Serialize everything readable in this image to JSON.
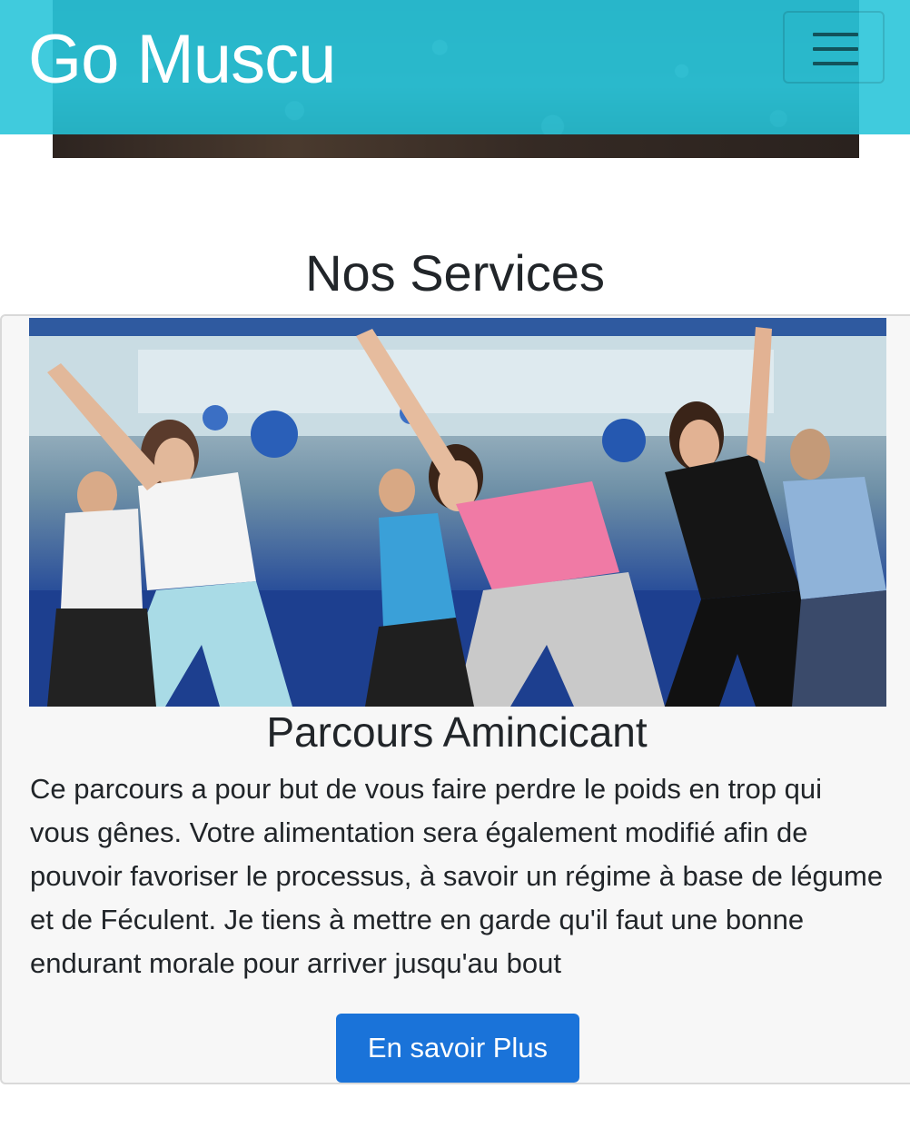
{
  "navbar": {
    "brand": "Go Muscu",
    "toggler_icon": "hamburger-menu-icon",
    "color": "#26c4d8"
  },
  "services": {
    "heading": "Nos Services",
    "card": {
      "image": "group-stretching-fitness-class-photo",
      "title": "Parcours Amincicant",
      "text": "Ce parcours a pour but de vous faire perdre le poids en trop qui vous gênes. Votre alimentation sera également modifié afin de pouvoir favoriser le processus, à savoir un régime à base de légume et de Féculent. Je tiens à mettre en garde qu'il faut une bonne endurant morale pour arriver jusqu'au bout",
      "button_label": "En savoir Plus",
      "button_color": "#1a73d9"
    }
  }
}
